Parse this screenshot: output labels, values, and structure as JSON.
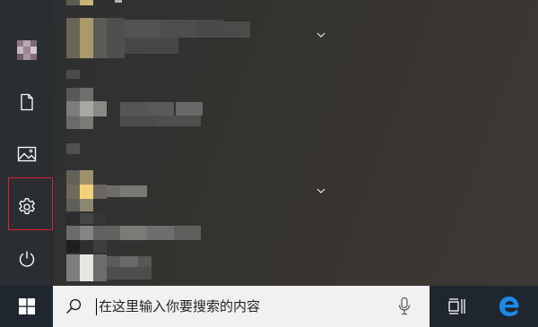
{
  "taskbar": {
    "search_placeholder": "在这里输入你要搜索的内容"
  },
  "rail": {
    "items": [
      {
        "icon": "user-avatar"
      },
      {
        "icon": "document-icon"
      },
      {
        "icon": "pictures-icon"
      },
      {
        "icon": "gear-icon",
        "highlighted": true
      },
      {
        "icon": "power-icon"
      }
    ]
  },
  "colors": {
    "highlight_border": "#e0202a",
    "edge_blue": "#1e88e5",
    "tile_yellow": "#f4d27a"
  }
}
